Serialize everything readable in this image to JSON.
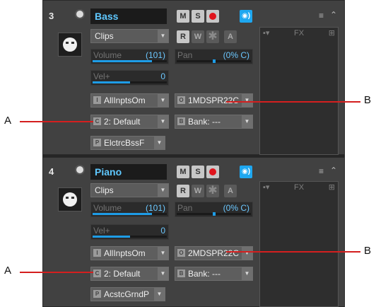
{
  "tracks": [
    {
      "number": "3",
      "name": "Bass",
      "buttons": {
        "mute": "M",
        "solo": "S",
        "read": "R",
        "write": "W",
        "archive": "A"
      },
      "clips_label": "Clips",
      "volume": {
        "label": "Volume",
        "value": "(101)",
        "level": 0.8
      },
      "pan": {
        "label": "Pan",
        "value": "(0% C)",
        "level": 0.5
      },
      "velocity": {
        "label": "Vel+",
        "value": "0",
        "level": 0.5
      },
      "input": "AllInptsOm",
      "output": "1MDSPR22C",
      "channel": "2: Default",
      "bank": "Bank: ---",
      "patch": "ElctrcBssF",
      "fx_label": "FX",
      "icons": {
        "input": "I",
        "output": "O",
        "channel": "C",
        "bank": "B",
        "patch": "P"
      }
    },
    {
      "number": "4",
      "name": "Piano",
      "buttons": {
        "mute": "M",
        "solo": "S",
        "read": "R",
        "write": "W",
        "archive": "A"
      },
      "clips_label": "Clips",
      "volume": {
        "label": "Volume",
        "value": "(101)",
        "level": 0.8
      },
      "pan": {
        "label": "Pan",
        "value": "(0% C)",
        "level": 0.5
      },
      "velocity": {
        "label": "Vel+",
        "value": "0",
        "level": 0.5
      },
      "input": "AllInptsOm",
      "output": "2MDSPR22C",
      "channel": "2: Default",
      "bank": "Bank: ---",
      "patch": "AcstcGrndP",
      "fx_label": "FX",
      "icons": {
        "input": "I",
        "output": "O",
        "channel": "C",
        "bank": "B",
        "patch": "P"
      }
    }
  ],
  "callouts": {
    "a_top": "A",
    "b_top": "B",
    "a_bottom": "A",
    "b_bottom": "B"
  },
  "colors": {
    "accent": "#1ea7f0",
    "record": "#e0141c",
    "callout": "#d41f1f"
  }
}
